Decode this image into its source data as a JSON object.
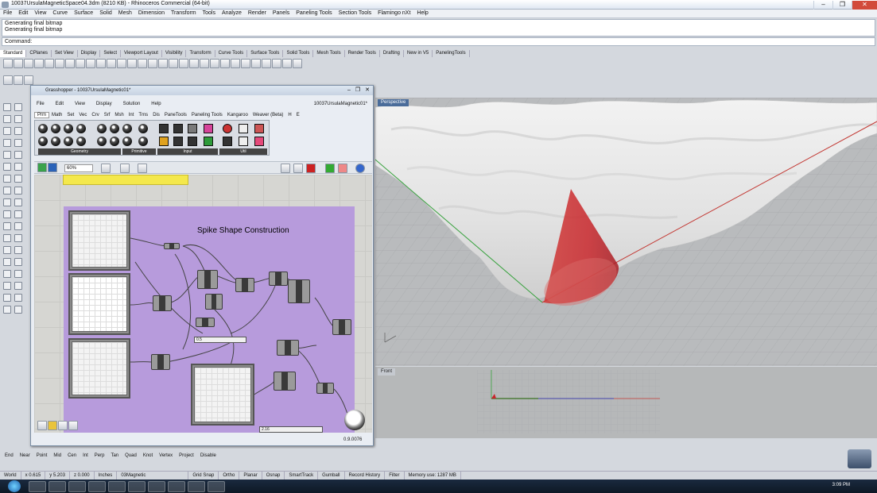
{
  "window": {
    "title": "10037UrsulaMagneticSpace04.3dm (8210 KB) - Rhinoceros Commercial (64-bit)",
    "controls": [
      "–",
      "❐",
      "✕"
    ]
  },
  "menu": [
    "File",
    "Edit",
    "View",
    "Curve",
    "Surface",
    "Solid",
    "Mesh",
    "Dimension",
    "Transform",
    "Tools",
    "Analyze",
    "Render",
    "Panels",
    "Paneling Tools",
    "Section Tools",
    "Flamingo nXt",
    "Help"
  ],
  "command_history": [
    "Generating final bitmap",
    "Generating final bitmap"
  ],
  "command_prompt": "Command:",
  "toolbar_tabs": [
    "Standard",
    "CPlanes",
    "Set View",
    "Display",
    "Select",
    "Viewport Layout",
    "Visibility",
    "Transform",
    "Curve Tools",
    "Surface Tools",
    "Solid Tools",
    "Mesh Tools",
    "Render Tools",
    "Drafting",
    "New in V5",
    "PanelingTools"
  ],
  "grasshopper": {
    "title": "Grasshopper - 10037UrsulaMagnetic01*",
    "menu": [
      "File",
      "Edit",
      "View",
      "Display",
      "Solution",
      "Help"
    ],
    "file_label": "10037UrsulaMagnetic01*",
    "tabs": [
      "Prm",
      "Math",
      "Set",
      "Vec",
      "Crv",
      "Srf",
      "Msh",
      "Int",
      "Trns",
      "Dis",
      "PaneTools",
      "Paneling Tools",
      "Kangaroo",
      "Weaver (Beta)",
      "H",
      "E"
    ],
    "groups": [
      "Geometry",
      "Primitive",
      "Input",
      "Util"
    ],
    "zoom": "60%",
    "group_title": "Spike Shape Construction",
    "slider_values": [
      "0.5",
      "2.16"
    ],
    "status": "0.9.0076"
  },
  "viewports": {
    "perspective": "Perspective",
    "front": "Front"
  },
  "osnaps": [
    "End",
    "Near",
    "Point",
    "Mid",
    "Cen",
    "Int",
    "Perp",
    "Tan",
    "Quad",
    "Knot",
    "Vertex",
    "Project",
    "Disable"
  ],
  "status_bar": {
    "cplane": "World",
    "x": "x 0.615",
    "y": "y 5.203",
    "z": "z 0.000",
    "unit": "Inches",
    "layer": "03Magnetic",
    "toggles": [
      "Grid Snap",
      "Ortho",
      "Planar",
      "Osnap",
      "SmartTrack",
      "Gumball",
      "Record History",
      "Filter"
    ],
    "memory": "Memory use: 1287 MB"
  },
  "taskbar": {
    "time": "3:09 PM"
  },
  "colors": {
    "purple_group": "#b79bdc",
    "cone": "#c8262b",
    "rhino_bg": "#d4d8de"
  }
}
